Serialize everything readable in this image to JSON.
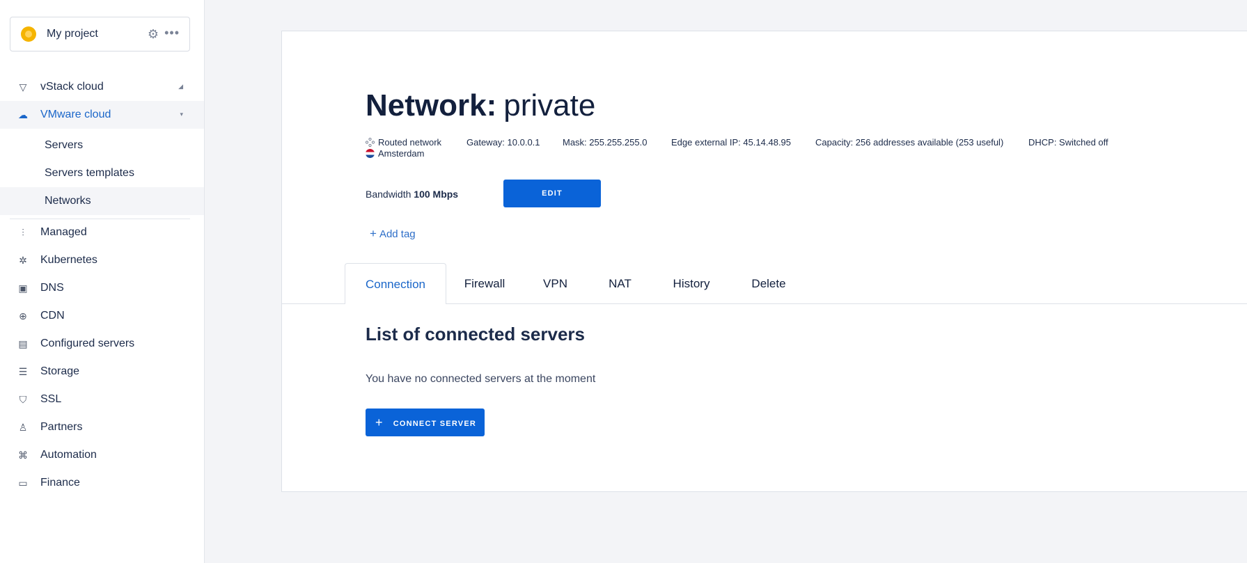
{
  "project": {
    "name": "My project"
  },
  "sidebar": {
    "groups": [
      {
        "label": "vStack cloud",
        "icon": "triangle-down-icon"
      },
      {
        "label": "VMware cloud",
        "icon": "cloud-icon",
        "active": true
      },
      {
        "label": "Managed",
        "icon": "sliders-icon"
      },
      {
        "label": "Kubernetes",
        "icon": "helm-icon"
      },
      {
        "label": "DNS",
        "icon": "dns-icon"
      },
      {
        "label": "CDN",
        "icon": "globe-icon"
      },
      {
        "label": "Configured servers",
        "icon": "configured-servers-icon"
      },
      {
        "label": "Storage",
        "icon": "database-icon"
      },
      {
        "label": "SSL",
        "icon": "shield-icon"
      },
      {
        "label": "Partners",
        "icon": "person-icon"
      },
      {
        "label": "Automation",
        "icon": "command-icon"
      },
      {
        "label": "Finance",
        "icon": "card-icon"
      }
    ],
    "subitems": [
      {
        "label": "Servers"
      },
      {
        "label": "Servers templates"
      },
      {
        "label": "Networks",
        "active": true
      }
    ]
  },
  "network": {
    "title_keyword": "Network:",
    "title_value": "private",
    "type": "Routed network",
    "location": "Amsterdam",
    "gateway": "Gateway: 10.0.0.1",
    "mask": "Mask: 255.255.255.0",
    "edge_ip": "Edge external IP: 45.14.48.95",
    "capacity": "Capacity: 256 addresses available (253 useful)",
    "dhcp": "DHCP: Switched off",
    "bandwidth_label": "Bandwidth",
    "bandwidth_value": "100 Mbps",
    "edit_label": "EDIT",
    "add_tag_label": "Add tag"
  },
  "tabs": [
    {
      "label": "Connection",
      "active": true
    },
    {
      "label": "Firewall"
    },
    {
      "label": "VPN"
    },
    {
      "label": "NAT"
    },
    {
      "label": "History"
    },
    {
      "label": "Delete"
    }
  ],
  "connection": {
    "heading": "List of connected servers",
    "empty_text": "You have no connected servers at the moment",
    "connect_label": "CONNECT SERVER"
  },
  "colors": {
    "accent": "#0a63d8",
    "active_text": "#1a66c9",
    "background": "#f3f4f7"
  }
}
